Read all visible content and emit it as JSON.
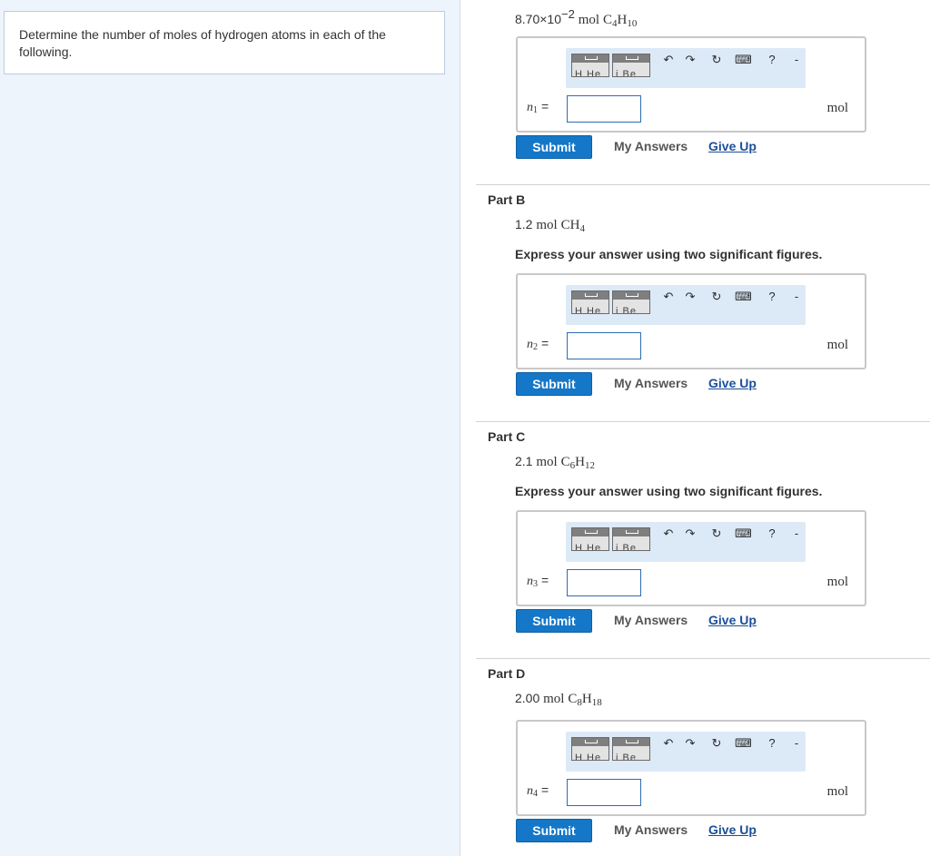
{
  "question": {
    "text": "Determine the number of moles of hydrogen atoms in each of the following."
  },
  "toolbar": {
    "template1_label": "H He",
    "template2_label": "i Be",
    "undo_symbol": "↶",
    "redo_symbol": "↷",
    "reset_symbol": "↻",
    "keyboard_symbol": "⌨",
    "help_symbol": "?",
    "extra_symbol": "-"
  },
  "actions": {
    "submit_label": "Submit",
    "my_answers_label": "My Answers",
    "give_up_label": "Give Up"
  },
  "parts": [
    {
      "title": "",
      "given_coef": "8.70×10",
      "given_exp": "−2",
      "given_unit": "mol",
      "formula": [
        [
          "C",
          "4"
        ],
        [
          "H",
          "10"
        ]
      ],
      "instruction": "",
      "variable": "n",
      "variable_sub": "1",
      "input_value": "",
      "unit": "mol"
    },
    {
      "title": "Part B",
      "given_coef": "1.2",
      "given_exp": "",
      "given_unit": "mol",
      "formula": [
        [
          "C",
          ""
        ],
        [
          "H",
          "4"
        ]
      ],
      "instruction": "Express your answer using two significant figures.",
      "variable": "n",
      "variable_sub": "2",
      "input_value": "",
      "unit": "mol"
    },
    {
      "title": "Part C",
      "given_coef": "2.1",
      "given_exp": "",
      "given_unit": "mol",
      "formula": [
        [
          "C",
          "6"
        ],
        [
          "H",
          "12"
        ]
      ],
      "instruction": "Express your answer using two significant figures.",
      "variable": "n",
      "variable_sub": "3",
      "input_value": "",
      "unit": "mol"
    },
    {
      "title": "Part D",
      "given_coef": "2.00",
      "given_exp": "",
      "given_unit": "mol",
      "formula": [
        [
          "C",
          "8"
        ],
        [
          "H",
          "18"
        ]
      ],
      "instruction": "",
      "variable": "n",
      "variable_sub": "4",
      "input_value": "",
      "unit": "mol"
    }
  ]
}
